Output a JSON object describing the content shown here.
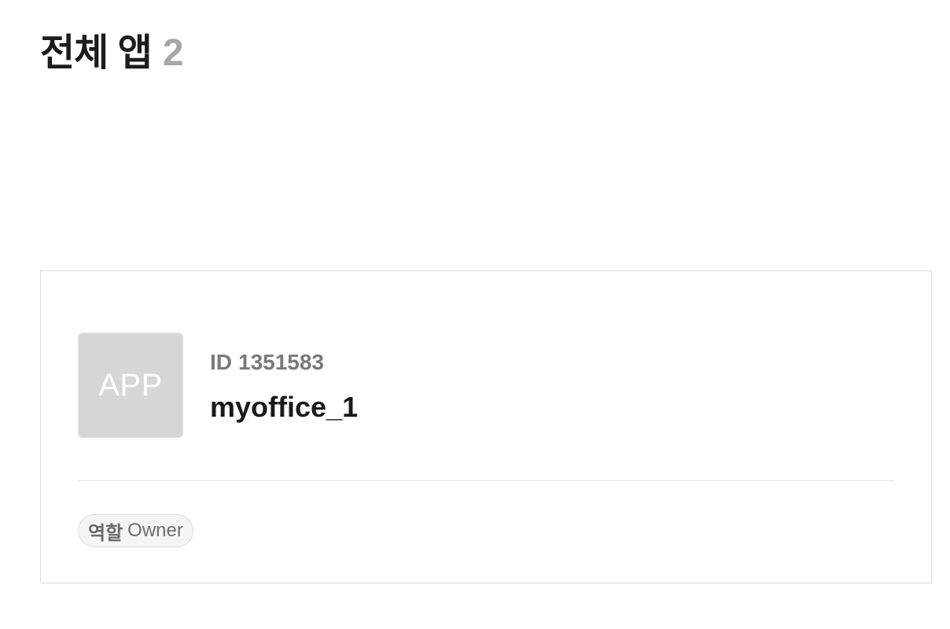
{
  "header": {
    "title": "전체 앱",
    "count": "2"
  },
  "apps": [
    {
      "thumbnail_text": "APP",
      "id_label": "ID",
      "id_value": "1351583",
      "name": "myoffice_1",
      "role_label": "역할",
      "role_value": "Owner"
    }
  ]
}
